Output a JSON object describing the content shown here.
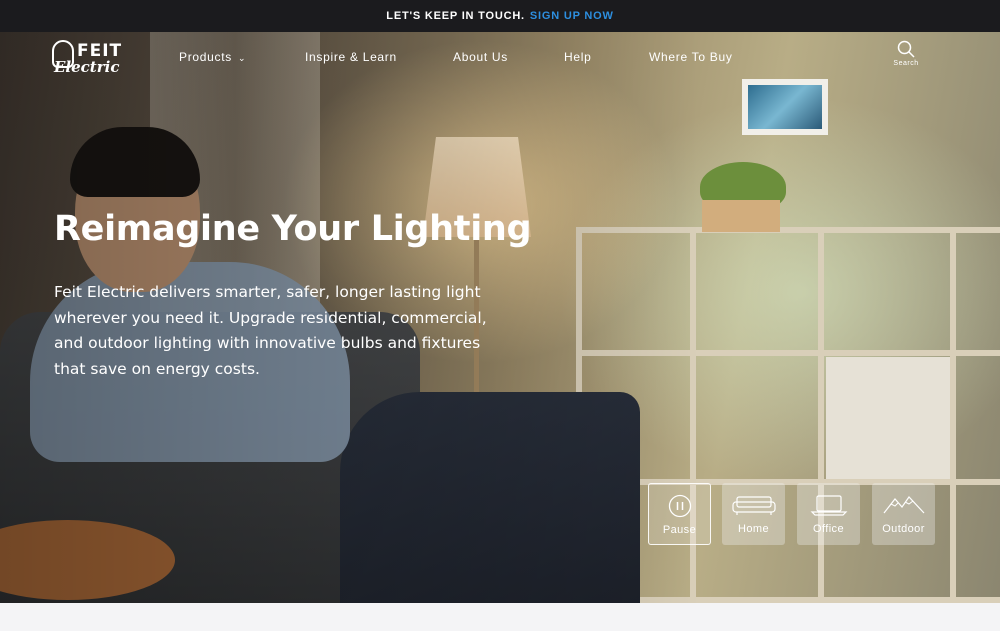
{
  "announcement": {
    "text": "LET'S KEEP IN TOUCH.",
    "cta": "SIGN UP NOW"
  },
  "brand": {
    "logo_line1": "FEIT",
    "logo_line2": "Electric",
    "accent": "#2d8fe0"
  },
  "nav": {
    "items": [
      {
        "label": "Products",
        "has_dropdown": true
      },
      {
        "label": "Inspire & Learn"
      },
      {
        "label": "About Us"
      },
      {
        "label": "Help"
      },
      {
        "label": "Where To Buy"
      }
    ],
    "search_label": "Search"
  },
  "hero": {
    "headline": "Reimagine Your Lighting",
    "description": "Feit Electric delivers smarter, safer, longer lasting light wherever you need it. Upgrade residential, commercial, and outdoor lighting with innovative bulbs and fixtures that save on energy costs."
  },
  "scene_controls": [
    {
      "label": "Pause",
      "icon": "pause-icon",
      "active": true
    },
    {
      "label": "Home",
      "icon": "sofa-icon"
    },
    {
      "label": "Office",
      "icon": "laptop-icon"
    },
    {
      "label": "Outdoor",
      "icon": "mountains-icon"
    }
  ]
}
